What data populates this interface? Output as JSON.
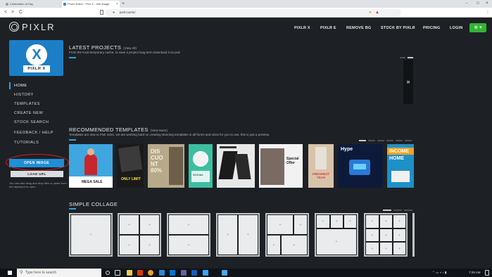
{
  "browser": {
    "tabs": [
      {
        "title": "Celebration of Day"
      },
      {
        "title": "Photo Editor : Pixlr X - free image"
      }
    ],
    "new_tab": "+",
    "nav": {
      "back": "<",
      "forward": ">",
      "reload": "C"
    },
    "url": "pixlr.com/x/",
    "window": {
      "minimize": "-",
      "maximize": "□",
      "close": "×"
    }
  },
  "site": {
    "logo": "PIXLR",
    "nav": [
      "PIXLR X",
      "PIXLR E",
      "REMOVE BG",
      "STOCK BY PIXLR",
      "PRICING",
      "LOGIN"
    ],
    "account_icon": "globe-icon"
  },
  "sidebar": {
    "app_badge": "PIXLR X",
    "app_letter": "X",
    "items": [
      {
        "label": "HOME"
      },
      {
        "label": "HISTORY"
      },
      {
        "label": "TEMPLATES"
      },
      {
        "label": "CREATE NEW"
      },
      {
        "label": "STOCK SEARCH"
      },
      {
        "label": "FEEDBACK / HELP"
      },
      {
        "label": "TUTORIALS"
      }
    ],
    "open_image": "OPEN IMAGE",
    "load_url": "LOAD URL",
    "note": "You can also drag and drop files or paste from the clipboard to open."
  },
  "latest": {
    "title": "LATEST PROJECTS",
    "view_all": "(View All)",
    "subtitle": "From the local temporary cache, to save a project long term download it as pxd.",
    "next_arrow": "»"
  },
  "templates": {
    "title": "RECOMMENDED TEMPLATES",
    "view_more": "(View More)",
    "subtitle": "Templates are new to Pixlr 2021, we are working hard on creating stunning templates in all forms and sizes for you to use, this is just a preview.",
    "items": [
      {
        "text": "MEGA SALE",
        "bg": "#3fa6e0"
      },
      {
        "text": "ONLY LIMIT",
        "bg": "#1a1a1a"
      },
      {
        "text": "DIS CUO NT 80%",
        "bg": "#b7a98a"
      },
      {
        "text": "SOCIAL",
        "bg": "#3cbfa0"
      },
      {
        "text": "",
        "bg": "#e8e8e8"
      },
      {
        "text": "Special Offer",
        "bg": "#f2f2f2"
      },
      {
        "text": "FRESHEST TECH",
        "bg": "#d8c3aa"
      },
      {
        "text": "Hype",
        "bg": "#0d1a3a"
      },
      {
        "text": "INCOME HOME",
        "bg": "#1e90c8"
      }
    ]
  },
  "collage": {
    "title": "SIMPLE COLLAGE"
  },
  "taskbar": {
    "search_placeholder": "Type here to search",
    "time": "7:29 AM"
  }
}
